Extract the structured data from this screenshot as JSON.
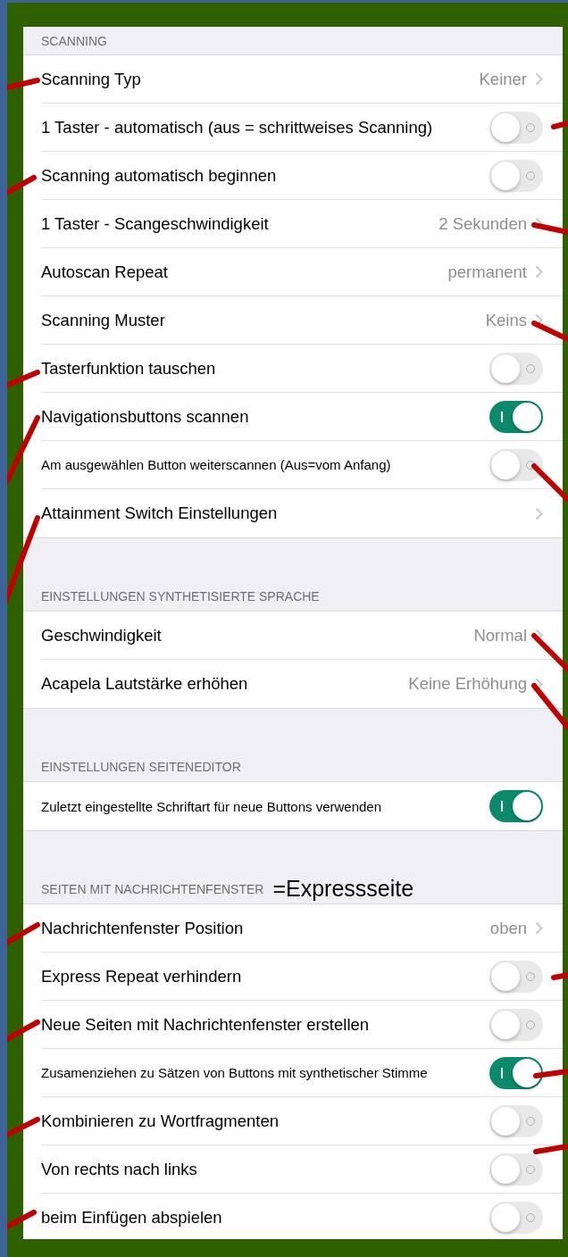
{
  "sections": [
    {
      "header": "SCANNING",
      "rows": [
        {
          "kind": "value",
          "label": "Scanning Typ",
          "value": "Keiner"
        },
        {
          "kind": "toggle",
          "label": "1 Taster - automatisch (aus = schrittweises Scanning)",
          "on": false
        },
        {
          "kind": "toggle",
          "label": "Scanning automatisch beginnen",
          "on": false
        },
        {
          "kind": "value",
          "label": "1 Taster - Scangeschwindigkeit",
          "value": "2 Sekunden"
        },
        {
          "kind": "value",
          "label": "Autoscan Repeat",
          "value": "permanent"
        },
        {
          "kind": "value",
          "label": "Scanning Muster",
          "value": "Keins"
        },
        {
          "kind": "toggle",
          "label": "Tasterfunktion tauschen",
          "on": false
        },
        {
          "kind": "toggle",
          "label": "Navigationsbuttons scannen",
          "on": true
        },
        {
          "kind": "toggle",
          "label": "Am ausgewählen Button weiterscannen (Aus=vom Anfang)",
          "on": false
        },
        {
          "kind": "link",
          "label": "Attainment Switch Einstellungen"
        }
      ]
    },
    {
      "header": "EINSTELLUNGEN SYNTHETISIERTE SPRACHE",
      "rows": [
        {
          "kind": "value",
          "label": "Geschwindigkeit",
          "value": "Normal"
        },
        {
          "kind": "value",
          "label": "Acapela Lautstärke erhöhen",
          "value": "Keine Erhöhung"
        }
      ]
    },
    {
      "header": "EINSTELLUNGEN SEITENEDITOR",
      "rows": [
        {
          "kind": "toggle",
          "label": "Zuletzt eingestellte Schriftart für neue Buttons verwenden",
          "on": true
        }
      ]
    },
    {
      "header": "SEITEN MIT NACHRICHTENFENSTER",
      "annotation": "=Expressseite",
      "rows": [
        {
          "kind": "value",
          "label": "Nachrichtenfenster Position",
          "value": "oben"
        },
        {
          "kind": "toggle",
          "label": "Express Repeat verhindern",
          "on": false
        },
        {
          "kind": "toggle",
          "label": "Neue Seiten mit Nachrichtenfenster erstellen",
          "on": false
        },
        {
          "kind": "toggle",
          "label": "Zusamenziehen zu Sätzen von Buttons mit synthetischer Stimme",
          "on": true
        },
        {
          "kind": "toggle",
          "label": "Kombinieren zu Wortfragmenten",
          "on": false
        },
        {
          "kind": "toggle",
          "label": "Von rechts nach links",
          "on": false
        },
        {
          "kind": "toggle",
          "label": "beim Einfügen abspielen",
          "on": false
        }
      ]
    }
  ]
}
